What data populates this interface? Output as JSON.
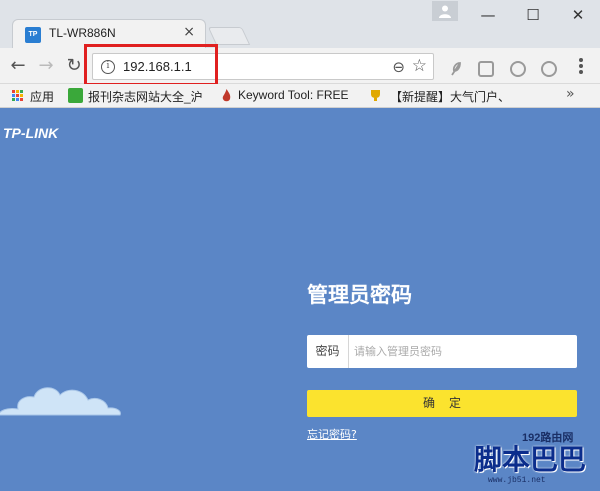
{
  "browser": {
    "tab": {
      "favicon_text": "TP",
      "title": "TL-WR886N",
      "close_glyph": "×"
    },
    "window_controls": {
      "minimize": "—",
      "maximize": "☐",
      "close": "✕"
    },
    "address_bar": {
      "url": "192.168.1.1"
    },
    "bookmarks": [
      {
        "label": "应用",
        "icon": "apps-icon"
      },
      {
        "label": "报刊杂志网站大全_沪",
        "icon": "green-c-icon"
      },
      {
        "label": "Keyword Tool: FREE",
        "icon": "flame-icon"
      },
      {
        "label": "【新提醒】大气门户、",
        "icon": "trophy-icon"
      }
    ]
  },
  "page": {
    "logo": "TP-LINK",
    "login": {
      "title": "管理员密码",
      "password_label": "密码",
      "password_placeholder": "请输入管理员密码",
      "confirm_label": "确定",
      "forgot_link": "忘记密码?"
    }
  },
  "watermark": {
    "small": "192路由网",
    "big": "脚本巴巴",
    "url": "www.jb51.net"
  },
  "colors": {
    "page_bg": "#5b86c6",
    "confirm_bg": "#fbe32e",
    "highlight": "#e02020"
  }
}
